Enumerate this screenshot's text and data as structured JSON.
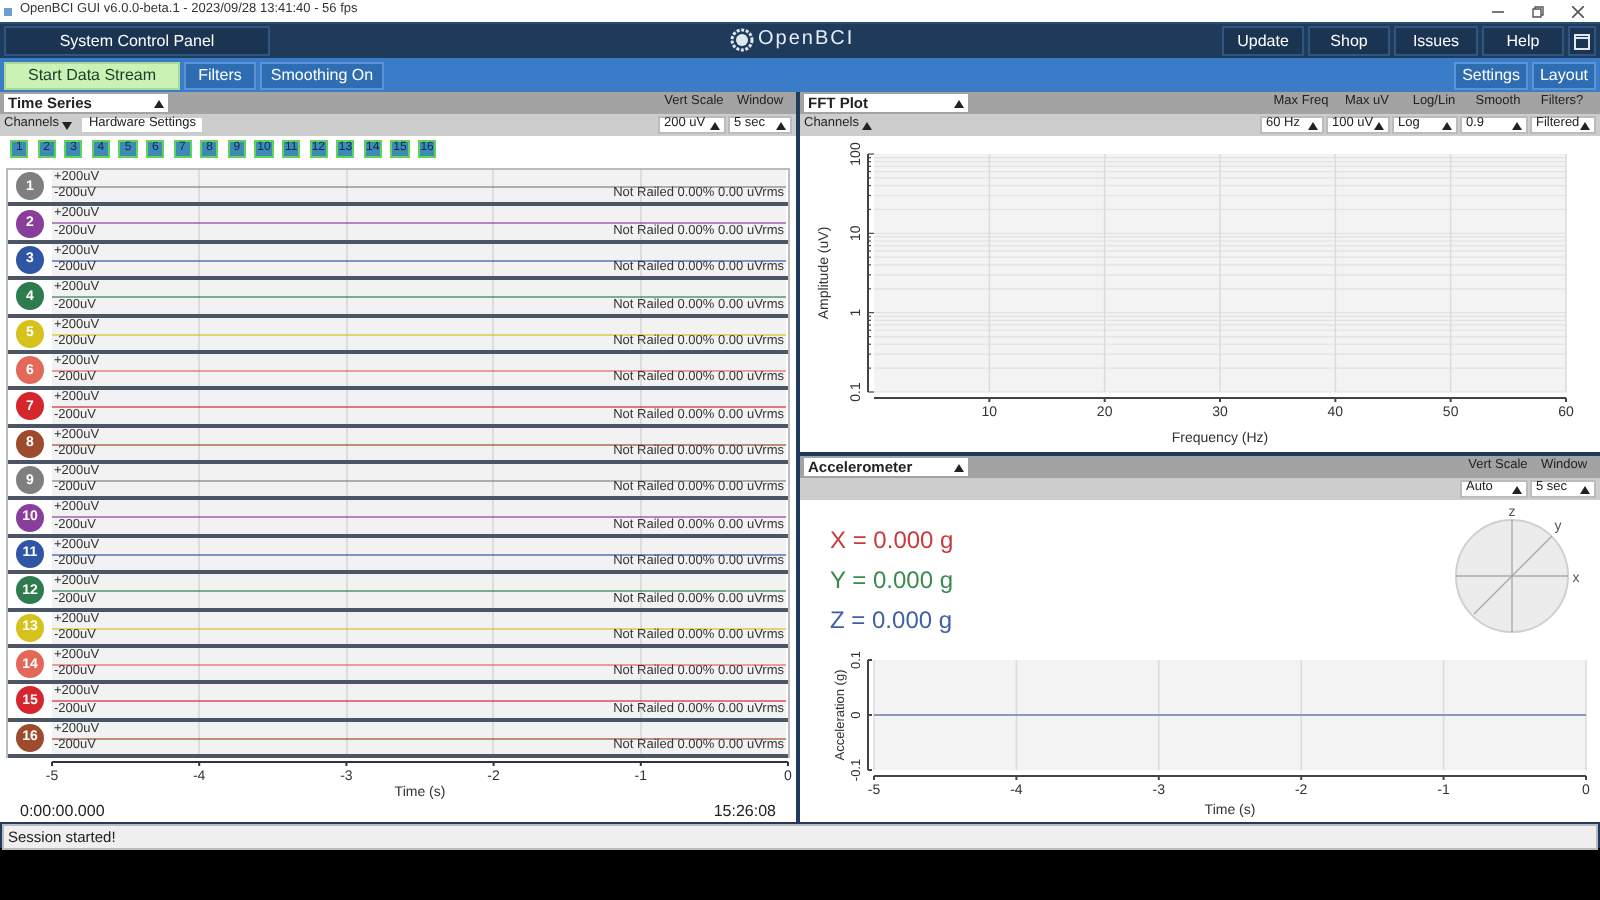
{
  "window": {
    "title": "OpenBCI GUI v6.0.0-beta.1 - 2023/09/28 13:41:40 - 56 fps"
  },
  "nav": {
    "system_button": "System Control Panel",
    "logo": "OpenBCI",
    "links": [
      "Update",
      "Shop",
      "Issues",
      "Help"
    ]
  },
  "toolbar": {
    "left_buttons": [
      {
        "label": "Start Data Stream",
        "kind": "start"
      },
      {
        "label": "Filters",
        "kind": "plain"
      },
      {
        "label": "Smoothing On",
        "kind": "plain"
      }
    ],
    "right_buttons": [
      "Settings",
      "Layout"
    ]
  },
  "time_series": {
    "widget": "Time Series",
    "channels_toggle": {
      "label": "Channels",
      "expanded": false
    },
    "hardware_settings": "Hardware Settings",
    "controls": [
      {
        "label": "Vert Scale",
        "value": "200 uV"
      },
      {
        "label": "Window",
        "value": "5 sec"
      }
    ],
    "channel_buttons": [
      {
        "label": "1",
        "selected": true
      },
      {
        "label": "2",
        "selected": true
      },
      {
        "label": "3",
        "selected": true
      },
      {
        "label": "4",
        "selected": true
      },
      {
        "label": "5",
        "selected": true
      },
      {
        "label": "6",
        "selected": true
      },
      {
        "label": "7",
        "selected": true
      },
      {
        "label": "8",
        "selected": true
      },
      {
        "label": "9",
        "selected": true
      },
      {
        "label": "10",
        "selected": true
      },
      {
        "label": "11",
        "selected": true
      },
      {
        "label": "12",
        "selected": true
      },
      {
        "label": "13",
        "selected": true
      },
      {
        "label": "14",
        "selected": true
      },
      {
        "label": "15",
        "selected": true
      },
      {
        "label": "16",
        "selected": true
      }
    ],
    "channels": [
      {
        "number": "1",
        "color": "#7f7f7f",
        "upper": "+200uV",
        "lower": "-200uV",
        "status": "Not Railed 0.00% 0.00 uVrms"
      },
      {
        "number": "2",
        "color": "#8a3e9c",
        "upper": "+200uV",
        "lower": "-200uV",
        "status": "Not Railed 0.00% 0.00 uVrms"
      },
      {
        "number": "3",
        "color": "#2f55a5",
        "upper": "+200uV",
        "lower": "-200uV",
        "status": "Not Railed 0.00% 0.00 uVrms"
      },
      {
        "number": "4",
        "color": "#2e7b4e",
        "upper": "+200uV",
        "lower": "-200uV",
        "status": "Not Railed 0.00% 0.00 uVrms"
      },
      {
        "number": "5",
        "color": "#d6c21c",
        "upper": "+200uV",
        "lower": "-200uV",
        "status": "Not Railed 0.00% 0.00 uVrms"
      },
      {
        "number": "6",
        "color": "#e2685a",
        "upper": "+200uV",
        "lower": "-200uV",
        "status": "Not Railed 0.00% 0.00 uVrms"
      },
      {
        "number": "7",
        "color": "#d5262e",
        "upper": "+200uV",
        "lower": "-200uV",
        "status": "Not Railed 0.00% 0.00 uVrms"
      },
      {
        "number": "8",
        "color": "#9e4a2c",
        "upper": "+200uV",
        "lower": "-200uV",
        "status": "Not Railed 0.00% 0.00 uVrms"
      },
      {
        "number": "9",
        "color": "#7f7f7f",
        "upper": "+200uV",
        "lower": "-200uV",
        "status": "Not Railed 0.00% 0.00 uVrms"
      },
      {
        "number": "10",
        "color": "#8a3e9c",
        "upper": "+200uV",
        "lower": "-200uV",
        "status": "Not Railed 0.00% 0.00 uVrms"
      },
      {
        "number": "11",
        "color": "#2f55a5",
        "upper": "+200uV",
        "lower": "-200uV",
        "status": "Not Railed 0.00% 0.00 uVrms"
      },
      {
        "number": "12",
        "color": "#2e7b4e",
        "upper": "+200uV",
        "lower": "-200uV",
        "status": "Not Railed 0.00% 0.00 uVrms"
      },
      {
        "number": "13",
        "color": "#d6c21c",
        "upper": "+200uV",
        "lower": "-200uV",
        "status": "Not Railed 0.00% 0.00 uVrms"
      },
      {
        "number": "14",
        "color": "#e2685a",
        "upper": "+200uV",
        "lower": "-200uV",
        "status": "Not Railed 0.00% 0.00 uVrms"
      },
      {
        "number": "15",
        "color": "#d5262e",
        "upper": "+200uV",
        "lower": "-200uV",
        "status": "Not Railed 0.00% 0.00 uVrms"
      },
      {
        "number": "16",
        "color": "#9e4a2c",
        "upper": "+200uV",
        "lower": "-200uV",
        "status": "Not Railed 0.00% 0.00 uVrms"
      }
    ],
    "x_ticks": [
      "-5",
      "-4",
      "-3",
      "-2",
      "-1",
      "0"
    ],
    "x_label": "Time (s)",
    "elapsed": "0:00:00.000",
    "clock": "15:26:08"
  },
  "fft": {
    "widget": "FFT Plot",
    "channels_toggle": {
      "label": "Channels",
      "expanded": true
    },
    "controls": [
      {
        "label": "Max Freq",
        "value": "60 Hz"
      },
      {
        "label": "Max uV",
        "value": "100 uV"
      },
      {
        "label": "Log/Lin",
        "value": "Log"
      },
      {
        "label": "Smooth",
        "value": "0.9"
      },
      {
        "label": "Filters?",
        "value": "Filtered"
      }
    ],
    "plot": {
      "xlabel": "Frequency (Hz)",
      "ylabel": "Amplitude (uV)",
      "x_ticks": [
        "10",
        "20",
        "30",
        "40",
        "50",
        "60"
      ],
      "y_ticks": [
        "0.1",
        "1",
        "10",
        "100"
      ]
    }
  },
  "accelerometer": {
    "widget": "Accelerometer",
    "controls": [
      {
        "label": "Vert Scale",
        "value": "Auto"
      },
      {
        "label": "Window",
        "value": "5 sec"
      }
    ],
    "readings": [
      {
        "text": "X = 0.000 g",
        "color": "#c8393c"
      },
      {
        "text": "Y = 0.000 g",
        "color": "#3a8a4f"
      },
      {
        "text": "Z = 0.000 g",
        "color": "#3e5fa8"
      }
    ],
    "axis_labels": [
      "z",
      "y",
      "x"
    ],
    "chart_data": {
      "type": "line",
      "xlabel": "Time (s)",
      "ylabel": "Acceleration (g)",
      "xlim": [
        -5,
        0
      ],
      "ylim": [
        -0.1,
        0.1
      ],
      "xticks": [
        -5,
        -4,
        -3,
        -2,
        -1,
        0
      ],
      "yticks": [
        {
          "value": -0.1,
          "label": "-0.1"
        },
        {
          "value": 0,
          "label": "0"
        },
        {
          "value": 0.1,
          "label": "0.1"
        }
      ],
      "grid": true,
      "x": [
        -5,
        0
      ],
      "series": [
        {
          "color": "#8c99ba",
          "values": [
            0,
            0
          ]
        }
      ]
    }
  },
  "status_bar": "Session started!"
}
